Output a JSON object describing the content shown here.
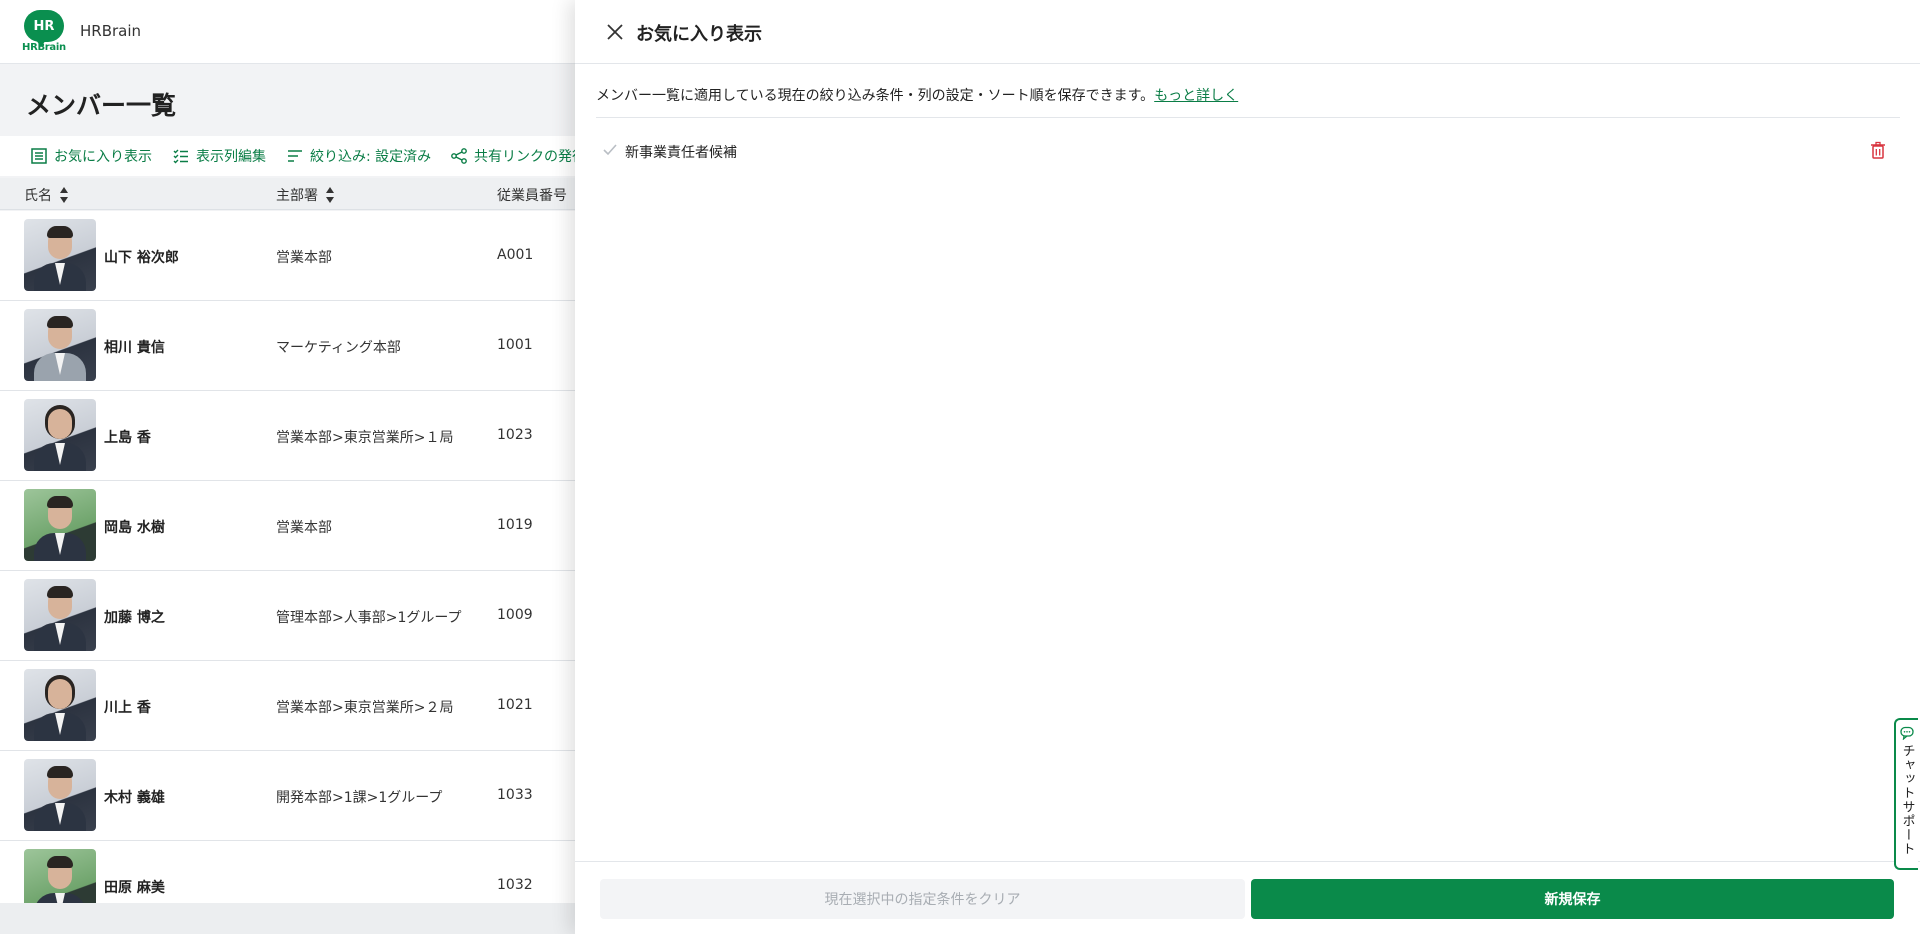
{
  "app": {
    "logo_text": "HR",
    "logo_sub": "HRBrain",
    "name": "HRBrain"
  },
  "page": {
    "title": "メンバー一覧"
  },
  "toolbar": {
    "favorites": "お気に入り表示",
    "columns": "表示列編集",
    "filter": "絞り込み: 設定済み",
    "share": "共有リンクの発行"
  },
  "table": {
    "headers": {
      "name": "氏名",
      "dept": "主部署",
      "empno": "従業員番号"
    },
    "rows": [
      {
        "name": "山下 裕次郎",
        "dept": "営業本部",
        "empno": "A001"
      },
      {
        "name": "相川 貴信",
        "dept": "マーケティング本部",
        "empno": "1001"
      },
      {
        "name": "上島 香",
        "dept": "営業本部>東京営業所>１局",
        "empno": "1023"
      },
      {
        "name": "岡島 水樹",
        "dept": "営業本部",
        "empno": "1019"
      },
      {
        "name": "加藤 博之",
        "dept": "管理本部>人事部>1グループ",
        "empno": "1009"
      },
      {
        "name": "川上 香",
        "dept": "営業本部>東京営業所>２局",
        "empno": "1021"
      },
      {
        "name": "木村 義雄",
        "dept": "開発本部>1課>1グループ",
        "empno": "1033"
      },
      {
        "name": "田原 麻美",
        "dept": "",
        "empno": "1032"
      }
    ]
  },
  "drawer": {
    "title": "お気に入り表示",
    "description": "メンバー一覧に適用している現在の絞り込み条件・列の設定・ソート順を保存できます。",
    "more_link": "もっと詳しく",
    "favorites": [
      {
        "label": "新事業責任者候補"
      }
    ],
    "clear_button": "現在選択中の指定条件をクリア",
    "save_button": "新規保存"
  },
  "chat": {
    "label": "チャットサポート"
  },
  "colors": {
    "brand": "#0a8a4a",
    "danger": "#d9343f",
    "link": "#0a7d46"
  }
}
